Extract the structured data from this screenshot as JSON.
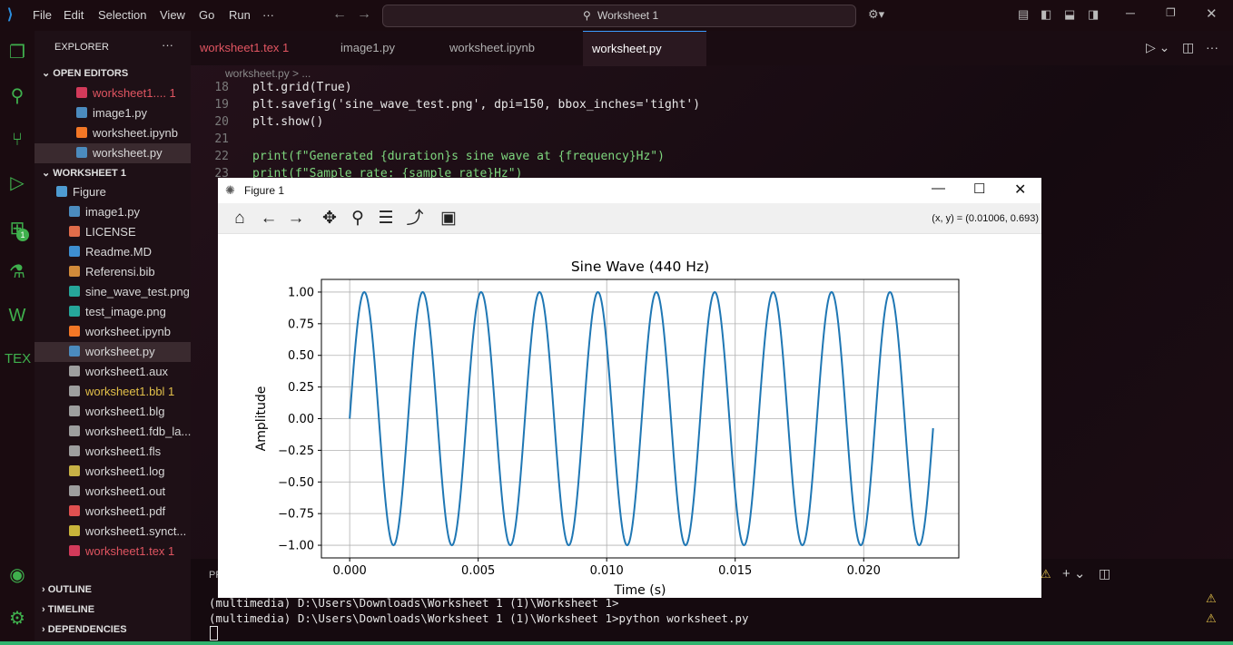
{
  "menu": [
    "File",
    "Edit",
    "Selection",
    "View",
    "Go",
    "Run",
    "···"
  ],
  "command_center": "Worksheet 1",
  "sidebar": {
    "explorer_title": "EXPLORER",
    "open_editors_title": "OPEN EDITORS",
    "open_editors": [
      {
        "label": "worksheet1.... 1",
        "color": "#e05561",
        "icon": "#d23a5a"
      },
      {
        "label": "image1.py",
        "color": "#d8d8d8",
        "icon": "#4b8bbe"
      },
      {
        "label": "worksheet.ipynb",
        "color": "#d8d8d8",
        "icon": "#f37726"
      },
      {
        "label": "worksheet.py",
        "color": "#d8d8d8",
        "icon": "#4b8bbe"
      }
    ],
    "folder_title": "WORKSHEET 1",
    "folder_items": [
      {
        "label": "Figure",
        "color": "#d8d8d8",
        "icon": "#4e9bd1"
      },
      {
        "label": "image1.py",
        "color": "#d8d8d8",
        "icon": "#4b8bbe"
      },
      {
        "label": "LICENSE",
        "color": "#d8d8d8",
        "icon": "#e06c4a"
      },
      {
        "label": "Readme.MD",
        "color": "#d8d8d8",
        "icon": "#3e8ed0"
      },
      {
        "label": "Referensi.bib",
        "color": "#d8d8d8",
        "icon": "#d18a3a"
      },
      {
        "label": "sine_wave_test.png",
        "color": "#d8d8d8",
        "icon": "#26a69a"
      },
      {
        "label": "test_image.png",
        "color": "#d8d8d8",
        "icon": "#26a69a"
      },
      {
        "label": "worksheet.ipynb",
        "color": "#d8d8d8",
        "icon": "#f37726"
      },
      {
        "label": "worksheet.py",
        "color": "#d8d8d8",
        "icon": "#4b8bbe"
      },
      {
        "label": "worksheet1.aux",
        "color": "#d8d8d8",
        "icon": "#9e9e9e"
      },
      {
        "label": "worksheet1.bbl 1",
        "color": "#e2c04a",
        "icon": "#9e9e9e"
      },
      {
        "label": "worksheet1.blg",
        "color": "#d8d8d8",
        "icon": "#9e9e9e"
      },
      {
        "label": "worksheet1.fdb_la...",
        "color": "#d8d8d8",
        "icon": "#9e9e9e"
      },
      {
        "label": "worksheet1.fls",
        "color": "#d8d8d8",
        "icon": "#9e9e9e"
      },
      {
        "label": "worksheet1.log",
        "color": "#d8d8d8",
        "icon": "#c7b146"
      },
      {
        "label": "worksheet1.out",
        "color": "#d8d8d8",
        "icon": "#9e9e9e"
      },
      {
        "label": "worksheet1.pdf",
        "color": "#d8d8d8",
        "icon": "#e05050"
      },
      {
        "label": "worksheet1.synct...",
        "color": "#d8d8d8",
        "icon": "#c9b43a"
      },
      {
        "label": "worksheet1.tex 1",
        "color": "#e05561",
        "icon": "#d23a5a"
      }
    ],
    "outline": "OUTLINE",
    "timeline": "TIMELINE",
    "dependencies": "DEPENDENCIES",
    "badge": "1"
  },
  "tabs": [
    {
      "label": "worksheet1.tex 1",
      "color": "#e05561"
    },
    {
      "label": "image1.py",
      "color": "#b0b0b0"
    },
    {
      "label": "worksheet.ipynb",
      "color": "#b0b0b0"
    },
    {
      "label": "worksheet.py",
      "color": "#ffffff"
    }
  ],
  "breadcrumb": "worksheet.py > ...",
  "code": [
    {
      "n": "18",
      "t": "plt.grid(True)"
    },
    {
      "n": "19",
      "t": "plt.savefig('sine_wave_test.png', dpi=150, bbox_inches='tight')"
    },
    {
      "n": "20",
      "t": "plt.show()"
    },
    {
      "n": "21",
      "t": ""
    },
    {
      "n": "22",
      "t": "print(f\"Generated {duration}s sine wave at {frequency}Hz\")"
    },
    {
      "n": "23",
      "t": "print(f\"Sample rate: {sample_rate}Hz\")"
    }
  ],
  "terminal": {
    "tab": "PR",
    "lines": [
      "(multimedia) D:\\Users\\Downloads\\Worksheet 1 (1)\\Worksheet 1>",
      "(multimedia) D:\\Users\\Downloads\\Worksheet 1 (1)\\Worksheet 1>python worksheet.py"
    ]
  },
  "figure": {
    "title": "Figure 1",
    "coords": "(x, y) = (0.01006, 0.693)"
  },
  "chart_data": {
    "type": "line",
    "title": "Sine Wave (440 Hz)",
    "xlabel": "Time (s)",
    "ylabel": "Amplitude",
    "xlim": [
      -0.0011,
      0.0237
    ],
    "ylim": [
      -1.1,
      1.1
    ],
    "xticks": [
      "0.000",
      "0.005",
      "0.010",
      "0.015",
      "0.020"
    ],
    "xtick_values": [
      0,
      0.005,
      0.01,
      0.015,
      0.02
    ],
    "yticks": [
      "1.00",
      "0.75",
      "0.50",
      "0.25",
      "0.00",
      "−0.25",
      "−0.50",
      "−0.75",
      "−1.00"
    ],
    "ytick_values": [
      1,
      0.75,
      0.5,
      0.25,
      0,
      -0.25,
      -0.5,
      -0.75,
      -1
    ],
    "grid": true,
    "series": [
      {
        "frequency_hz": 440,
        "amplitude": 1.0,
        "x_range": [
          0,
          0.0227
        ],
        "color": "#1f77b4"
      }
    ]
  }
}
